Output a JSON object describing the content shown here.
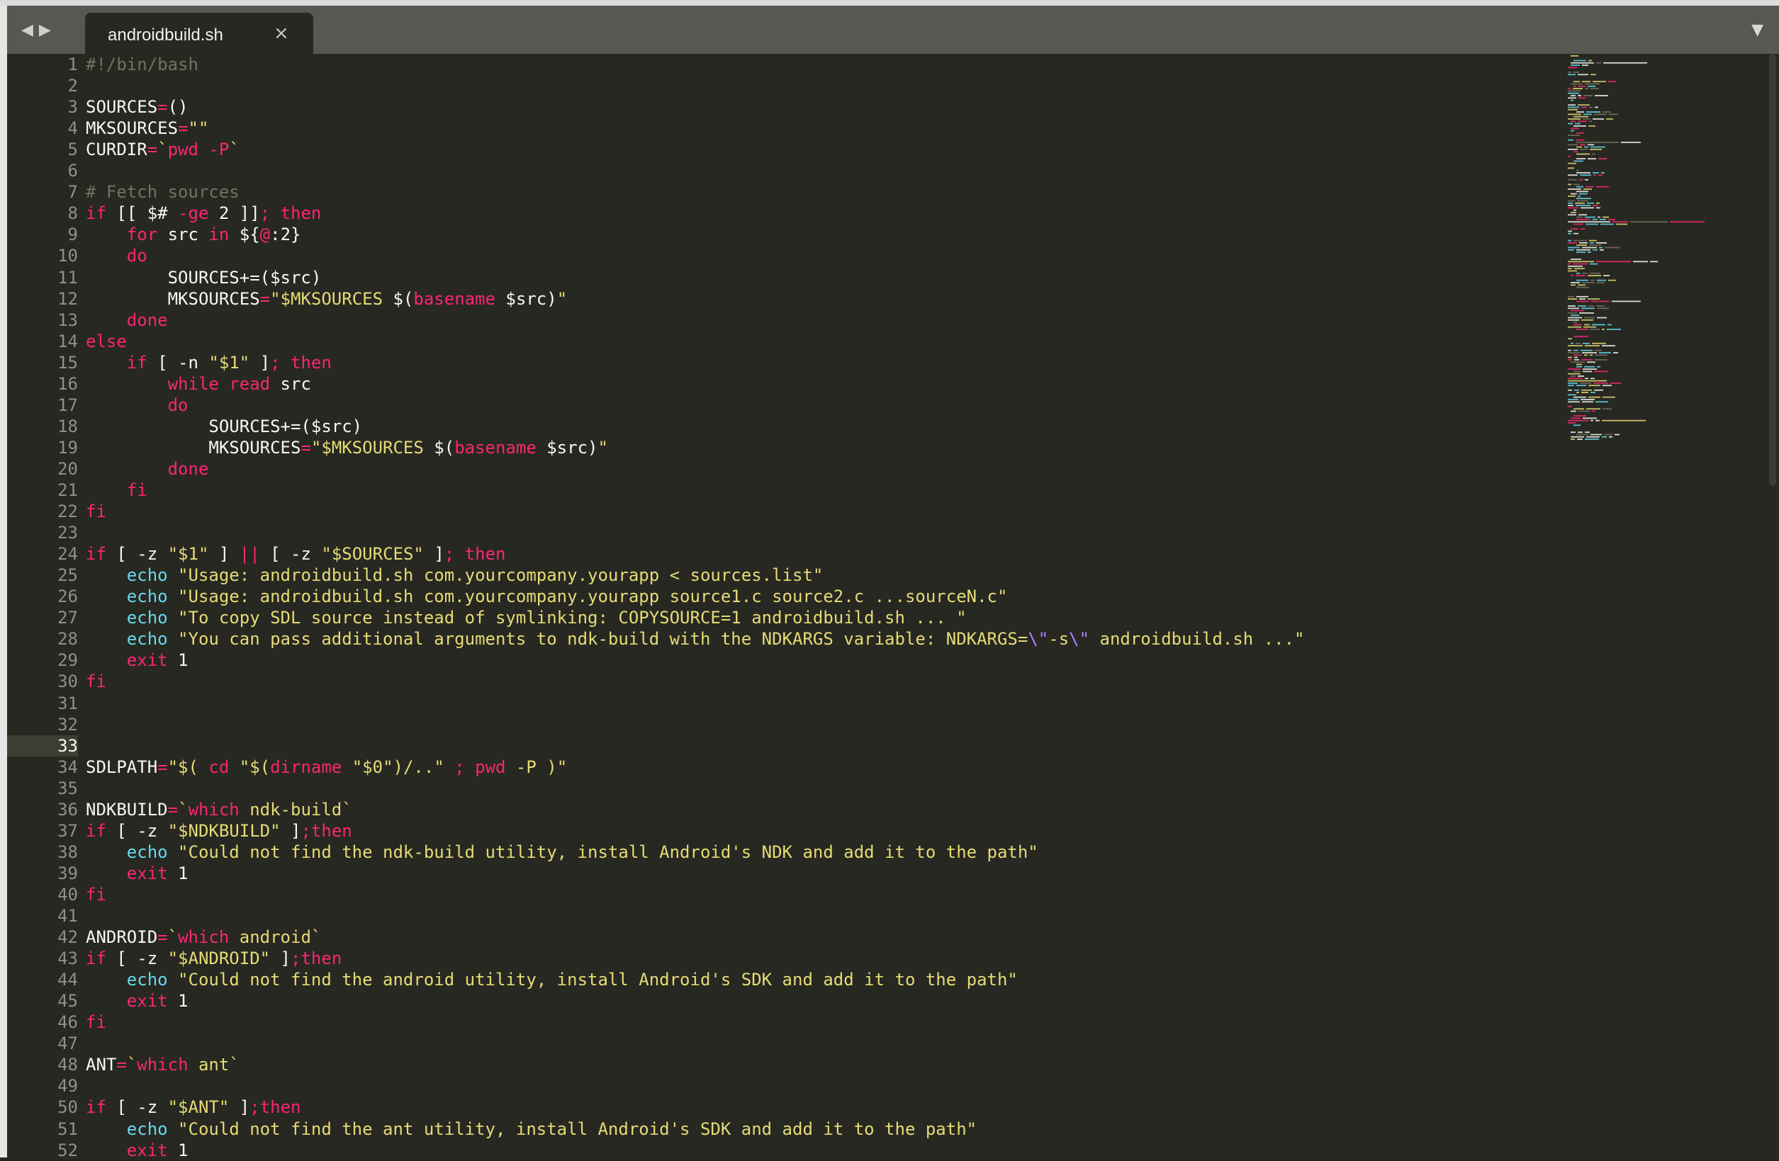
{
  "tab": {
    "title": "androidbuild.sh",
    "close_glyph": "×"
  },
  "nav": {
    "back_glyph": "◀",
    "forward_glyph": "▶"
  },
  "dropdown_glyph": "▼",
  "current_line": 33,
  "colors": {
    "background": "#272822",
    "keyword": "#f92672",
    "string": "#e6db74",
    "comment": "#75715e",
    "builtin": "#66d9ef",
    "number": "#ae81ff",
    "plain": "#f8f8f2",
    "line_number": "#8f908a"
  },
  "lines": [
    [
      [
        "#!/bin/bash",
        "comment"
      ]
    ],
    [],
    [
      [
        "SOURCES",
        "plain"
      ],
      [
        "=",
        "kw"
      ],
      [
        "()",
        "plain"
      ]
    ],
    [
      [
        "MKSOURCES",
        "plain"
      ],
      [
        "=",
        "kw"
      ],
      [
        "\"\"",
        "str"
      ]
    ],
    [
      [
        "CURDIR",
        "plain"
      ],
      [
        "=",
        "kw"
      ],
      [
        "`",
        "str"
      ],
      [
        "pwd -P",
        "kw"
      ],
      [
        "`",
        "str"
      ]
    ],
    [],
    [
      [
        "# Fetch sources",
        "comment"
      ]
    ],
    [
      [
        "if",
        "kw"
      ],
      [
        " [[ $# ",
        "plain"
      ],
      [
        "-ge",
        "kw"
      ],
      [
        " 2 ]]",
        "plain"
      ],
      [
        "; then",
        "kw"
      ]
    ],
    [
      [
        "    ",
        "plain"
      ],
      [
        "for",
        "kw"
      ],
      [
        " src ",
        "plain"
      ],
      [
        "in",
        "kw"
      ],
      [
        " ${",
        "plain"
      ],
      [
        "@",
        "kw"
      ],
      [
        ":2}",
        "plain"
      ]
    ],
    [
      [
        "    ",
        "plain"
      ],
      [
        "do",
        "kw"
      ]
    ],
    [
      [
        "        SOURCES+=($src)",
        "plain"
      ]
    ],
    [
      [
        "        MKSOURCES",
        "plain"
      ],
      [
        "=",
        "kw"
      ],
      [
        "\"$MKSOURCES ",
        "str"
      ],
      [
        "$(",
        "plain"
      ],
      [
        "basename",
        "kw"
      ],
      [
        " $src)",
        "plain"
      ],
      [
        "\"",
        "str"
      ]
    ],
    [
      [
        "    ",
        "plain"
      ],
      [
        "done",
        "kw"
      ]
    ],
    [
      [
        "else",
        "kw"
      ]
    ],
    [
      [
        "    ",
        "plain"
      ],
      [
        "if",
        "kw"
      ],
      [
        " [ -n ",
        "plain"
      ],
      [
        "\"$1\"",
        "str"
      ],
      [
        " ]",
        "plain"
      ],
      [
        "; then",
        "kw"
      ]
    ],
    [
      [
        "        ",
        "plain"
      ],
      [
        "while",
        "kw"
      ],
      [
        " ",
        "plain"
      ],
      [
        "read",
        "kw"
      ],
      [
        " src",
        "plain"
      ]
    ],
    [
      [
        "        ",
        "plain"
      ],
      [
        "do",
        "kw"
      ]
    ],
    [
      [
        "            SOURCES+=($src)",
        "plain"
      ]
    ],
    [
      [
        "            MKSOURCES",
        "plain"
      ],
      [
        "=",
        "kw"
      ],
      [
        "\"$MKSOURCES ",
        "str"
      ],
      [
        "$(",
        "plain"
      ],
      [
        "basename",
        "kw"
      ],
      [
        " $src)",
        "plain"
      ],
      [
        "\"",
        "str"
      ]
    ],
    [
      [
        "        ",
        "plain"
      ],
      [
        "done",
        "kw"
      ]
    ],
    [
      [
        "    ",
        "plain"
      ],
      [
        "fi",
        "kw"
      ]
    ],
    [
      [
        "fi",
        "kw"
      ]
    ],
    [],
    [
      [
        "if",
        "kw"
      ],
      [
        " [ -z ",
        "plain"
      ],
      [
        "\"$1\"",
        "str"
      ],
      [
        " ] ",
        "plain"
      ],
      [
        "||",
        "kw"
      ],
      [
        " [ -z ",
        "plain"
      ],
      [
        "\"$SOURCES\"",
        "str"
      ],
      [
        " ]",
        "plain"
      ],
      [
        "; then",
        "kw"
      ]
    ],
    [
      [
        "    ",
        "plain"
      ],
      [
        "echo",
        "cmd"
      ],
      [
        " ",
        "plain"
      ],
      [
        "\"Usage: androidbuild.sh com.yourcompany.yourapp < sources.list\"",
        "str"
      ]
    ],
    [
      [
        "    ",
        "plain"
      ],
      [
        "echo",
        "cmd"
      ],
      [
        " ",
        "plain"
      ],
      [
        "\"Usage: androidbuild.sh com.yourcompany.yourapp source1.c source2.c ...sourceN.c\"",
        "str"
      ]
    ],
    [
      [
        "    ",
        "plain"
      ],
      [
        "echo",
        "cmd"
      ],
      [
        " ",
        "plain"
      ],
      [
        "\"To copy SDL source instead of symlinking: COPYSOURCE=1 androidbuild.sh ... \"",
        "str"
      ]
    ],
    [
      [
        "    ",
        "plain"
      ],
      [
        "echo",
        "cmd"
      ],
      [
        " ",
        "plain"
      ],
      [
        "\"You can pass additional arguments to ndk-build with the NDKARGS variable: NDKARGS=",
        "str"
      ],
      [
        "\\\"",
        "num"
      ],
      [
        "-s",
        "str"
      ],
      [
        "\\\"",
        "num"
      ],
      [
        " androidbuild.sh ...\"",
        "str"
      ]
    ],
    [
      [
        "    ",
        "plain"
      ],
      [
        "exit",
        "kw"
      ],
      [
        " 1",
        "plain"
      ]
    ],
    [
      [
        "fi",
        "kw"
      ]
    ],
    [],
    [],
    [],
    [
      [
        "SDLPATH",
        "plain"
      ],
      [
        "=",
        "kw"
      ],
      [
        "\"$( ",
        "str"
      ],
      [
        "cd",
        "kw"
      ],
      [
        " \"$(",
        "str"
      ],
      [
        "dirname",
        "kw"
      ],
      [
        " \"$0\"",
        "str"
      ],
      [
        ")/..\" ",
        "str"
      ],
      [
        ";",
        "kw"
      ],
      [
        " ",
        "plain"
      ],
      [
        "pwd",
        "kw"
      ],
      [
        " -P )\"",
        "str"
      ]
    ],
    [],
    [
      [
        "NDKBUILD",
        "plain"
      ],
      [
        "=",
        "kw"
      ],
      [
        "`",
        "str"
      ],
      [
        "which",
        "kw"
      ],
      [
        " ndk-build`",
        "str"
      ]
    ],
    [
      [
        "if",
        "kw"
      ],
      [
        " [ -z ",
        "plain"
      ],
      [
        "\"$NDKBUILD\"",
        "str"
      ],
      [
        " ]",
        "plain"
      ],
      [
        ";then",
        "kw"
      ]
    ],
    [
      [
        "    ",
        "plain"
      ],
      [
        "echo",
        "cmd"
      ],
      [
        " ",
        "plain"
      ],
      [
        "\"Could not find the ndk-build utility, install Android's NDK and add it to the path\"",
        "str"
      ]
    ],
    [
      [
        "    ",
        "plain"
      ],
      [
        "exit",
        "kw"
      ],
      [
        " 1",
        "plain"
      ]
    ],
    [
      [
        "fi",
        "kw"
      ]
    ],
    [],
    [
      [
        "ANDROID",
        "plain"
      ],
      [
        "=",
        "kw"
      ],
      [
        "`",
        "str"
      ],
      [
        "which",
        "kw"
      ],
      [
        " android`",
        "str"
      ]
    ],
    [
      [
        "if",
        "kw"
      ],
      [
        " [ -z ",
        "plain"
      ],
      [
        "\"$ANDROID\"",
        "str"
      ],
      [
        " ]",
        "plain"
      ],
      [
        ";then",
        "kw"
      ]
    ],
    [
      [
        "    ",
        "plain"
      ],
      [
        "echo",
        "cmd"
      ],
      [
        " ",
        "plain"
      ],
      [
        "\"Could not find the android utility, install Android's SDK and add it to the path\"",
        "str"
      ]
    ],
    [
      [
        "    ",
        "plain"
      ],
      [
        "exit",
        "kw"
      ],
      [
        " 1",
        "plain"
      ]
    ],
    [
      [
        "fi",
        "kw"
      ]
    ],
    [],
    [
      [
        "ANT",
        "plain"
      ],
      [
        "=",
        "kw"
      ],
      [
        "`",
        "str"
      ],
      [
        "which",
        "kw"
      ],
      [
        " ant`",
        "str"
      ]
    ],
    [],
    [
      [
        "if",
        "kw"
      ],
      [
        " [ -z ",
        "plain"
      ],
      [
        "\"$ANT\"",
        "str"
      ],
      [
        " ]",
        "plain"
      ],
      [
        ";then",
        "kw"
      ]
    ],
    [
      [
        "    ",
        "plain"
      ],
      [
        "echo",
        "cmd"
      ],
      [
        " ",
        "plain"
      ],
      [
        "\"Could not find the ant utility, install Android's SDK and add it to the path\"",
        "str"
      ]
    ],
    [
      [
        "    ",
        "plain"
      ],
      [
        "exit",
        "kw"
      ],
      [
        " 1",
        "plain"
      ]
    ]
  ]
}
